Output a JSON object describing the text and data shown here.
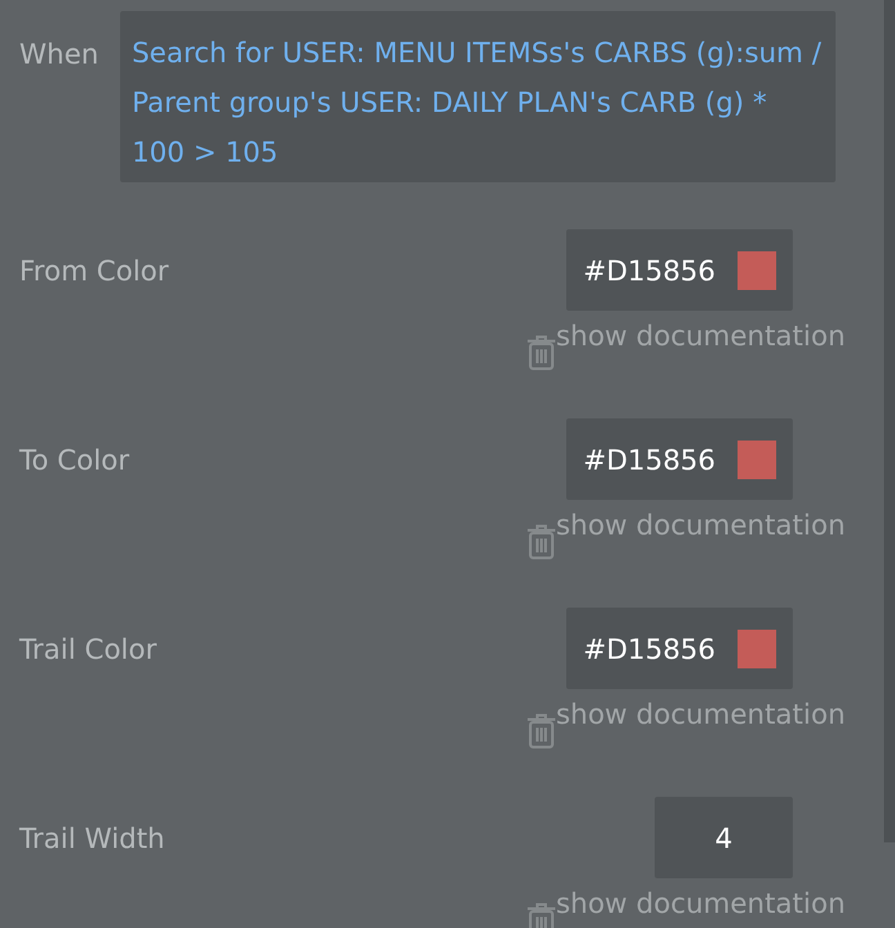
{
  "condition": {
    "label": "When",
    "expression": "Search for USER: MENU ITEMSs's CARBS (g):sum / Parent group's USER: DAILY PLAN's CARB (g) * 100 > 105"
  },
  "properties": [
    {
      "label": "From Color",
      "kind": "color",
      "value": "#D15856",
      "color": "#c45c58",
      "doc_link": "show documentation"
    },
    {
      "label": "To Color",
      "kind": "color",
      "value": "#D15856",
      "color": "#c45c58",
      "doc_link": "show documentation"
    },
    {
      "label": "Trail Color",
      "kind": "color",
      "value": "#D15856",
      "color": "#c45c58",
      "doc_link": "show documentation"
    },
    {
      "label": "Trail Width",
      "kind": "number",
      "value": "4",
      "doc_link": "show documentation"
    }
  ]
}
